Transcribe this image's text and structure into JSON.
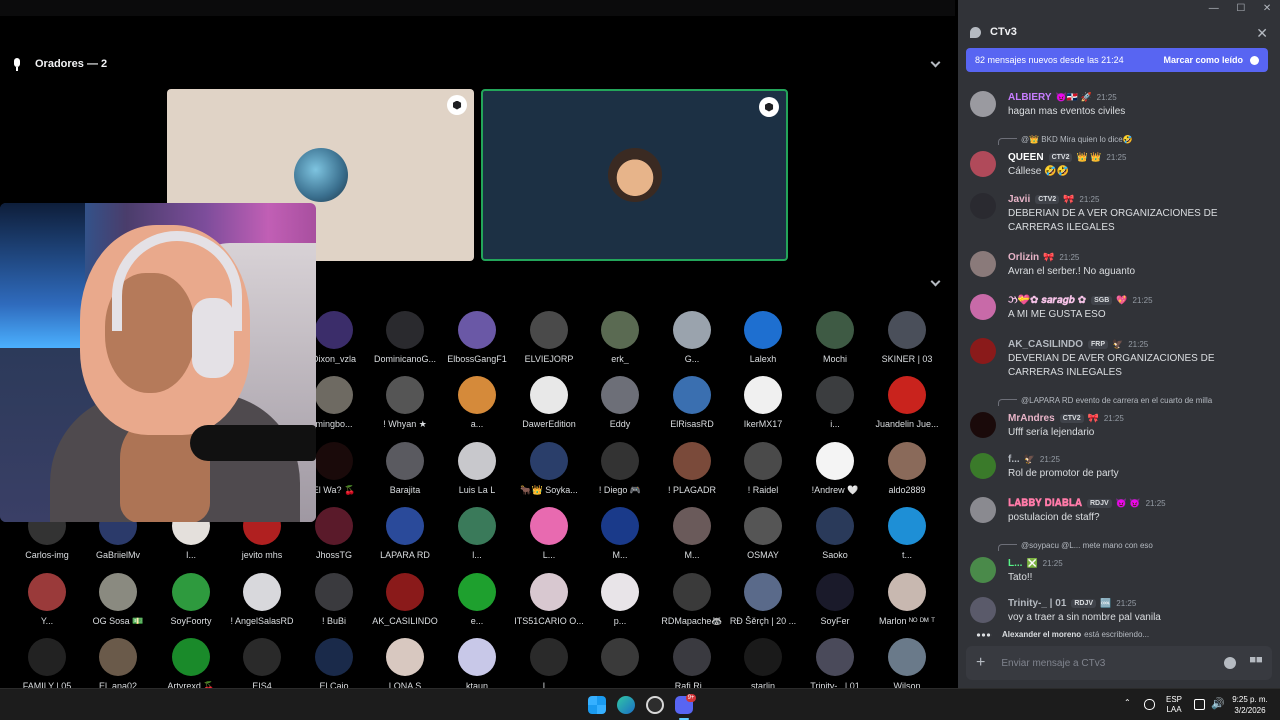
{
  "stage": {
    "speakers_title": "Oradores — 2",
    "audience": [
      {
        "name": "Dixon_vzla",
        "color": "#3b2d6a"
      },
      {
        "name": "DominicanoG...",
        "color": "#2a2a2e"
      },
      {
        "name": "ElbossGangF1",
        "color": "#6a58a6"
      },
      {
        "name": "ELVIEJORP",
        "color": "#4a4a4a"
      },
      {
        "name": "erk_",
        "color": "#5a6a52"
      },
      {
        "name": "G...",
        "color": "#9aa3ad"
      },
      {
        "name": "Lalexh",
        "color": "#1e6fd0"
      },
      {
        "name": "Mochi",
        "color": "#3e5a44"
      },
      {
        "name": "SKINER | 03",
        "color": "#4a4f5a"
      },
      {
        "name": "mingbo...",
        "color": "#6e6a62"
      },
      {
        "name": "! Whyan ★",
        "color": "#555"
      },
      {
        "name": "a...",
        "color": "#d58a3a"
      },
      {
        "name": "DawerEdition",
        "color": "#e8e8e8"
      },
      {
        "name": "Eddy",
        "color": "#6d6f78"
      },
      {
        "name": "ElRisasRD",
        "color": "#3a6fb0"
      },
      {
        "name": "IkerMX17",
        "color": "#f0f0f0"
      },
      {
        "name": "i...",
        "color": "#3b3d3f"
      },
      {
        "name": "Juandelin Jue...",
        "color": "#c9231d"
      },
      {
        "name": "El Wa? 🍒",
        "color": "#1a0a0a"
      },
      {
        "name": "Barajita",
        "color": "#5a5a60"
      },
      {
        "name": "Luis La L",
        "color": "#c8c8cc"
      },
      {
        "name": "🐂👑 Soyka...",
        "color": "#2a3e6a"
      },
      {
        "name": "! Diego 🎮",
        "color": "#333"
      },
      {
        "name": "! PLAGADR",
        "color": "#7a4a3a"
      },
      {
        "name": "! Raidel",
        "color": "#4a4a4a"
      },
      {
        "name": "!Andrew 🤍",
        "color": "#f4f4f4"
      },
      {
        "name": "aldo2889",
        "color": "#8a6a5a"
      },
      {
        "name": "Carlos-img",
        "color": "#333"
      },
      {
        "name": "GaBriielMv",
        "color": "#2b3a6a"
      },
      {
        "name": "I...",
        "color": "#e4e0dc"
      },
      {
        "name": "jevito mhs",
        "color": "#b02020"
      },
      {
        "name": "JhossTG",
        "color": "#5a1a2a"
      },
      {
        "name": "LAPARA RD",
        "color": "#2a4a9a"
      },
      {
        "name": "l...",
        "color": "#3a7a5a"
      },
      {
        "name": "L...",
        "color": "#e86ab0"
      },
      {
        "name": "M...",
        "color": "#1a3a8a"
      },
      {
        "name": "M...",
        "color": "#6a5a5a"
      },
      {
        "name": "OSMAY",
        "color": "#555"
      },
      {
        "name": "Saoko",
        "color": "#2a3a5a"
      },
      {
        "name": "t...",
        "color": "#1e8fd6"
      },
      {
        "name": "Y...",
        "color": "#9a3a3a"
      },
      {
        "name": "OG Sosa 💵",
        "color": "#8a8a80"
      },
      {
        "name": "SoyFoorty",
        "color": "#2e9a3e"
      },
      {
        "name": "! AngelSalasRD",
        "color": "#d8d8dc"
      },
      {
        "name": "! BuBi",
        "color": "#3a3a3e"
      },
      {
        "name": "AK_CASILINDO",
        "color": "#8a1a1a"
      },
      {
        "name": "e...",
        "color": "#1ea02e"
      },
      {
        "name": "ITS51CARIO O...",
        "color": "#d8c8d0"
      },
      {
        "name": "p...",
        "color": "#e8e4e8"
      },
      {
        "name": "RDMapache🦝",
        "color": "#3a3a3a"
      },
      {
        "name": "RĐ Šěrçh | 20 ...",
        "color": "#5a6a8a"
      },
      {
        "name": "SoyFer",
        "color": "#1a1a2a"
      },
      {
        "name": "Marlon ᴺᴼ ᴰᴹ ᵀ",
        "color": "#c8b8b0"
      },
      {
        "name": "FAMILY | 05",
        "color": "#222"
      },
      {
        "name": "El_ana02",
        "color": "#6a5a4a"
      },
      {
        "name": "Artyrexd 🍒",
        "color": "#1a8a2a"
      },
      {
        "name": "EIS4",
        "color": "#2a2a2a"
      },
      {
        "name": "El Caio",
        "color": "#1a2a4a"
      },
      {
        "name": "LONA S",
        "color": "#d8c8c0"
      },
      {
        "name": "ktaun",
        "color": "#c8c8e8"
      },
      {
        "name": "L...",
        "color": "#2a2a2a"
      },
      {
        "name": "...",
        "color": "#3a3a3a"
      },
      {
        "name": "Rafi Ri...",
        "color": "#3a3a40"
      },
      {
        "name": "starlin",
        "color": "#1a1a1a"
      },
      {
        "name": "Trinity-_ | 01",
        "color": "#4a4a5a"
      },
      {
        "name": "Wilson",
        "color": "#6a7a8a"
      }
    ]
  },
  "chat": {
    "title": "CTv3",
    "new_messages_text": "82 mensajes nuevos desde las 21:24",
    "mark_read_label": "Marcar como leído",
    "composer_placeholder": "Enviar mensaje a CTv3",
    "typing_user": "Alexander el moreno",
    "typing_text": "está escribiendo...",
    "messages": [
      {
        "user": "ALBIERY",
        "user_color": "#c77dff",
        "tag": "",
        "badge": "😈🇩🇴 🚀",
        "time": "21:25",
        "text": "hagan mas eventos civiles",
        "avatar": "#9a9aa0",
        "reply": ""
      },
      {
        "user": "QUEEN",
        "user_color": "#ffffff",
        "tag": "CTV2",
        "badge": "👑 👑",
        "time": "21:25",
        "text": "Cállese 🤣🤣",
        "avatar": "#b04a5a",
        "reply": "@👑 BKD  Mira quien lo dice🤣"
      },
      {
        "user": "Javii",
        "user_color": "#e8b4c8",
        "tag": "CTV2",
        "badge": "🎀",
        "time": "21:25",
        "text": "DEBERIAN DE A VER ORGANIZACIONES DE CARRERAS ILEGALES",
        "avatar": "#2a2a30",
        "reply": ""
      },
      {
        "user": "Orlizin",
        "user_color": "#e8b4c8",
        "tag": "",
        "badge": "🎀",
        "time": "21:25",
        "text": "Avran el serber.! No aguanto",
        "avatar": "#8a7a7a",
        "reply": ""
      },
      {
        "user": "ઝ💝✿ 𝒔𝒂𝒓𝒂𝒈𝒃 ✿",
        "user_color": "#f5c2e7",
        "tag": "SGB",
        "badge": "💖",
        "time": "21:25",
        "text": "A MI ME GUSTA ESO",
        "avatar": "#c86aa8",
        "reply": ""
      },
      {
        "user": "AK_CASILINDO",
        "user_color": "#b5bac1",
        "tag": "FRP",
        "badge": "🦅",
        "time": "21:25",
        "text": "DEVERIAN DE AVER ORGANIZACIONES DE CARRERAS INLEGALES",
        "avatar": "#8a1a1a",
        "reply": ""
      },
      {
        "user": "MrAndres",
        "user_color": "#e8b4c8",
        "tag": "CTV2",
        "badge": "🎀",
        "time": "21:25",
        "text": "Ufff sería lejendario",
        "avatar": "#1a0a0a",
        "reply": "@LAPARA RD  evento de carrera en el cuarto de milla"
      },
      {
        "user": "f...",
        "user_color": "#b5bac1",
        "tag": "",
        "badge": "🦅",
        "time": "21:25",
        "text": "Rol de promotor de party",
        "avatar": "#3a7a2a",
        "reply": ""
      },
      {
        "user": "𝐋𝐀𝐁𝐁𝐘 𝐃𝐈𝐀𝐁𝐋𝐀",
        "user_color": "#ff7aa8",
        "tag": "RDJV",
        "badge": "😈 😈",
        "time": "21:25",
        "text": "postulacion de staff?",
        "avatar": "#8a8a90",
        "reply": ""
      },
      {
        "user": "L...",
        "user_color": "#57f287",
        "tag": "",
        "badge": "❎",
        "time": "21:25",
        "text": "Tato!!",
        "avatar": "#4a8a4a",
        "reply": "@soypacu  @L...  mete mano con eso"
      },
      {
        "user": "Trinity-_ | 01",
        "user_color": "#b5bac1",
        "tag": "RDJV",
        "badge": "🆒",
        "time": "21:25",
        "text": "voy a traer a sin nombre pal vanila",
        "avatar": "#5a5a6a",
        "reply": ""
      }
    ]
  },
  "taskbar": {
    "lang": "ESP",
    "layout": "LAA",
    "time": "9:25 p. m.",
    "date": "3/2/2026",
    "discord_badge": "9+"
  }
}
